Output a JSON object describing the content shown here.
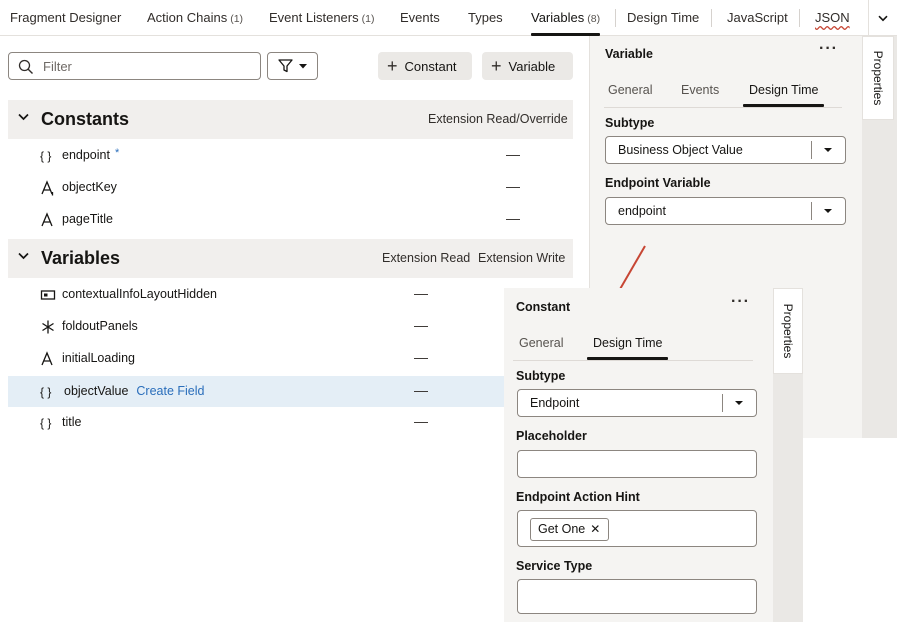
{
  "tabs": [
    {
      "label": "Fragment Designer",
      "count": ""
    },
    {
      "label": "Action Chains",
      "count": "(1)"
    },
    {
      "label": "Event Listeners",
      "count": "(1)"
    },
    {
      "label": "Events",
      "count": ""
    },
    {
      "label": "Types",
      "count": ""
    },
    {
      "label": "Variables",
      "count": "(8)"
    },
    {
      "label": "Design Time",
      "count": ""
    },
    {
      "label": "JavaScript",
      "count": ""
    },
    {
      "label": "JSON",
      "count": ""
    }
  ],
  "active_tab": "Variables",
  "toolbar": {
    "filter_placeholder": "Filter",
    "constant_button": "Constant",
    "variable_button": "Variable"
  },
  "constants_section": {
    "title": "Constants",
    "column": "Extension Read/Override",
    "rows": [
      {
        "name": "endpoint",
        "icon": "object-braces-icon",
        "marker": "*",
        "value": "—"
      },
      {
        "name": "objectKey",
        "icon": "string-key-icon",
        "value": "—"
      },
      {
        "name": "pageTitle",
        "icon": "string-icon",
        "value": "—"
      }
    ]
  },
  "variables_section": {
    "title": "Variables",
    "column_read": "Extension Read",
    "column_write": "Extension Write",
    "rows": [
      {
        "name": "contextualInfoLayoutHidden",
        "icon": "boolean-icon",
        "value": "—"
      },
      {
        "name": "foldoutPanels",
        "icon": "any-type-icon",
        "value": "—"
      },
      {
        "name": "initialLoading",
        "icon": "string-icon",
        "value": "—"
      },
      {
        "name": "objectValue",
        "icon": "object-braces-icon",
        "link": "Create Field",
        "value": "—",
        "selected": true
      },
      {
        "name": "title",
        "icon": "object-braces-icon",
        "value": "—"
      }
    ]
  },
  "variable_panel": {
    "title": "Variable",
    "tabs": [
      "General",
      "Events",
      "Design Time"
    ],
    "active_tab": "Design Time",
    "subtype_label": "Subtype",
    "subtype_value": "Business Object Value",
    "endpoint_variable_label": "Endpoint Variable",
    "endpoint_variable_value": "endpoint",
    "properties_tab": "Properties"
  },
  "constant_panel": {
    "title": "Constant",
    "tabs": [
      "General",
      "Design Time"
    ],
    "active_tab": "Design Time",
    "subtype_label": "Subtype",
    "subtype_value": "Endpoint",
    "placeholder_label": "Placeholder",
    "endpoint_action_hint_label": "Endpoint Action Hint",
    "endpoint_action_hint_chip": "Get One",
    "service_type_label": "Service Type",
    "properties_tab": "Properties"
  },
  "colors": {
    "link": "#2a6ebb",
    "selected_row": "#e4eef6",
    "section_header": "#f1efed",
    "panel_bg": "#f5f4f2",
    "annotation_arrow": "#c74634"
  }
}
